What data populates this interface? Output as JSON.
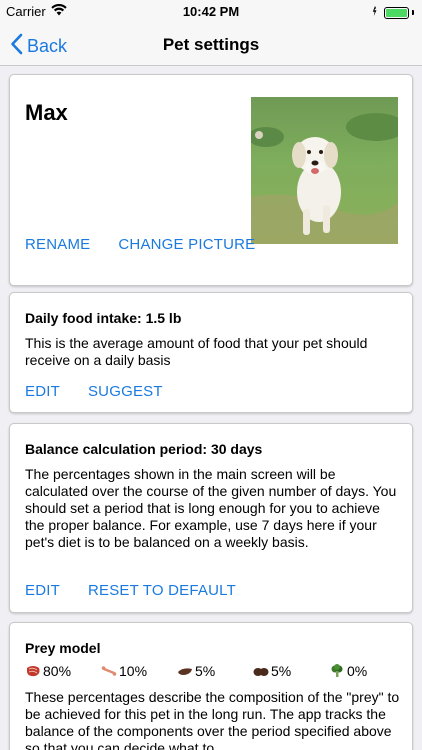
{
  "status": {
    "carrier": "Carrier",
    "time": "10:42 PM"
  },
  "nav": {
    "back_label": "Back",
    "title": "Pet settings"
  },
  "pet": {
    "name": "Max",
    "actions": {
      "rename": "RENAME",
      "change_picture": "CHANGE PICTURE"
    }
  },
  "food": {
    "title": "Daily food intake: 1.5 lb",
    "description": "This is the average amount of food that your pet should receive on a daily basis",
    "actions": {
      "edit": "EDIT",
      "suggest": "SUGGEST"
    }
  },
  "balance": {
    "title": "Balance calculation period: 30 days",
    "description": "The percentages shown in the main screen will be calculated over the course of the given number of days. You should set a period that is long enough for you to achieve the proper balance. For example, use 7 days here if your pet's diet is to be balanced on a weekly basis.",
    "actions": {
      "edit": "EDIT",
      "reset": "RESET TO DEFAULT"
    }
  },
  "prey": {
    "title": "Prey model",
    "items": [
      {
        "icon": "meat-icon",
        "value": "80%",
        "color": "#c0392b"
      },
      {
        "icon": "bone-icon",
        "value": "10%",
        "color": "#e08a70"
      },
      {
        "icon": "liver-icon",
        "value": "5%",
        "color": "#5a3322"
      },
      {
        "icon": "organ-icon",
        "value": "5%",
        "color": "#4a2a1a"
      },
      {
        "icon": "vegetable-icon",
        "value": "0%",
        "color": "#3c7a2a"
      }
    ],
    "description": "These percentages describe the composition of the \"prey\" to be achieved for this pet in the long run. The app tracks the balance of the components over the period specified above so that you can decide what to"
  },
  "colors": {
    "accent": "#1a7ae0",
    "background": "#efeff4"
  }
}
